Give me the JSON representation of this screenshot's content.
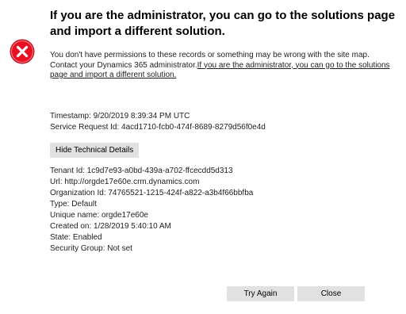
{
  "error": {
    "icon": "error-x-icon",
    "icon_color": "#e81123",
    "title": "If you are the administrator, you can go to the solutions page and import a different solution.",
    "message_plain": "You don't have permissions to these records or something may be wrong with the site map. Contact your Dynamics 365 administrator.",
    "message_link": "If you are the administrator, you can go to the solutions page and import a different solution."
  },
  "info": {
    "timestamp": "Timestamp: 9/20/2019 8:39:34 PM UTC",
    "service_request_id": "Service Request Id: 4acd1710-fcb0-474f-8689-8279d56f0e4d"
  },
  "technical": {
    "toggle_label": "Hide Technical Details",
    "lines": [
      "Tenant Id: 1c9d7e93-a0bd-439a-a702-ffcecdd5d313",
      "Url: http://orgde17e60e.crm.dynamics.com",
      "Organization Id: 74765521-1215-424f-a822-a3b4f66bbfba",
      "Type: Default",
      "Unique name: orgde17e60e",
      "Created on: 1/28/2019 5:40:10 AM",
      "State: Enabled",
      "Security Group: Not set"
    ]
  },
  "footer": {
    "try_again_label": "Try Again",
    "close_label": "Close"
  }
}
